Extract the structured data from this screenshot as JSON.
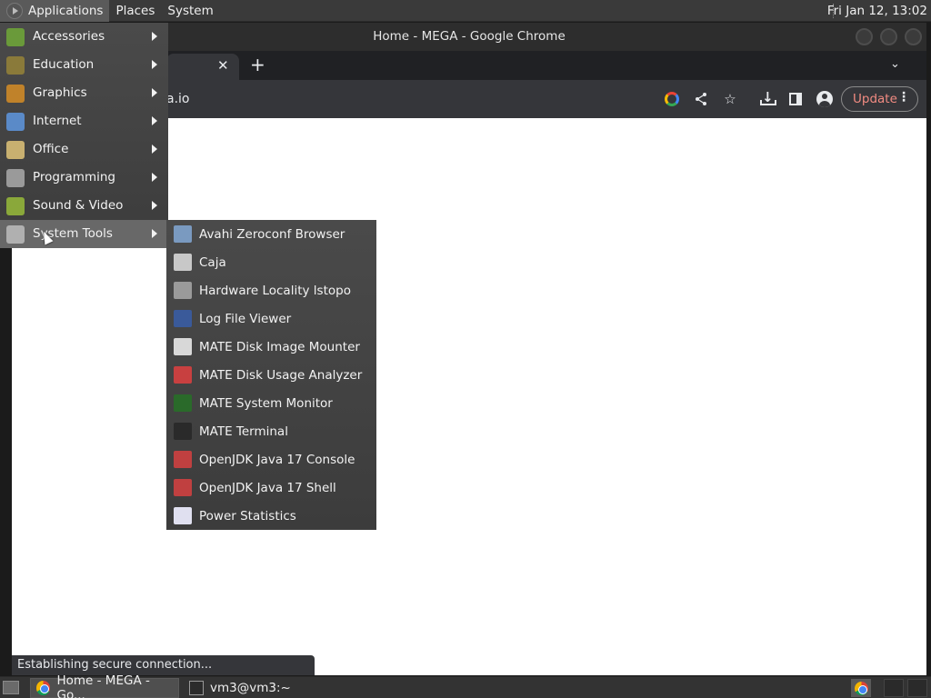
{
  "top_panel": {
    "menus": [
      "Applications",
      "Places",
      "System"
    ],
    "clock": "Fri Jan 12, 13:02"
  },
  "browser": {
    "window_title": "Home - MEGA - Google Chrome",
    "tab_close": "✕",
    "new_tab": "+",
    "tab_list": "⌄",
    "url_fragment": "a.io",
    "update_label": "Update",
    "menu_dots": "⋮",
    "status_text": "Establishing secure connection..."
  },
  "app_menu": {
    "items": [
      {
        "label": "Accessories",
        "icon": "accessories-icon",
        "color": "#6a9a3a"
      },
      {
        "label": "Education",
        "icon": "education-icon",
        "color": "#8a7a3a"
      },
      {
        "label": "Graphics",
        "icon": "graphics-icon",
        "color": "#c0822a"
      },
      {
        "label": "Internet",
        "icon": "internet-icon",
        "color": "#5a8ac8"
      },
      {
        "label": "Office",
        "icon": "office-icon",
        "color": "#c8b070"
      },
      {
        "label": "Programming",
        "icon": "programming-icon",
        "color": "#9a9a9a"
      },
      {
        "label": "Sound & Video",
        "icon": "sound-video-icon",
        "color": "#8aa83a"
      },
      {
        "label": "System Tools",
        "icon": "gear-icon",
        "color": "#b0b0b0"
      }
    ]
  },
  "system_tools": {
    "items": [
      {
        "label": "Avahi Zeroconf Browser",
        "icon": "avahi-icon",
        "color": "#7a9ac0"
      },
      {
        "label": "Caja",
        "icon": "caja-icon",
        "color": "#c8c8c8"
      },
      {
        "label": "Hardware Locality lstopo",
        "icon": "lstopo-icon",
        "color": "#9a9a9a"
      },
      {
        "label": "Log File Viewer",
        "icon": "log-viewer-icon",
        "color": "#3a5a9a"
      },
      {
        "label": "MATE Disk Image Mounter",
        "icon": "disk-mounter-icon",
        "color": "#d8d8d8"
      },
      {
        "label": "MATE Disk Usage Analyzer",
        "icon": "disk-usage-icon",
        "color": "#c84040"
      },
      {
        "label": "MATE System Monitor",
        "icon": "system-monitor-icon",
        "color": "#2a6a2a"
      },
      {
        "label": "MATE Terminal",
        "icon": "terminal-icon",
        "color": "#2a2a2a"
      },
      {
        "label": "OpenJDK Java 17 Console",
        "icon": "java-console-icon",
        "color": "#c04040"
      },
      {
        "label": "OpenJDK Java 17 Shell",
        "icon": "java-shell-icon",
        "color": "#c04040"
      },
      {
        "label": "Power Statistics",
        "icon": "power-statistics-icon",
        "color": "#e0e0f0"
      }
    ]
  },
  "taskbar": {
    "tasks": [
      "Home - MEGA - Go...",
      "vm3@vm3:~"
    ]
  }
}
